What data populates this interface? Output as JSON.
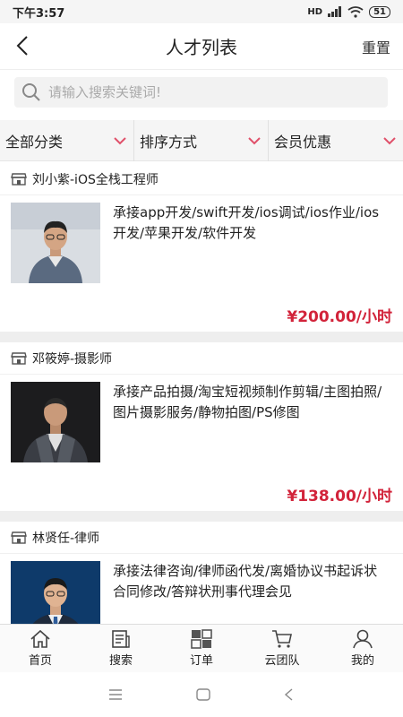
{
  "status_bar": {
    "time": "下午3:57",
    "signal": "HD",
    "battery": "51"
  },
  "header": {
    "title": "人才列表",
    "reset_label": "重置"
  },
  "search": {
    "placeholder": "请输入搜索关键词!"
  },
  "filters": [
    {
      "label": "全部分类"
    },
    {
      "label": "排序方式"
    },
    {
      "label": "会员优惠"
    }
  ],
  "listings": [
    {
      "name": "刘小紫-iOS全栈工程师",
      "description": "承接app开发/swift开发/ios调试/ios作业/ios开发/苹果开发/软件开发",
      "price": "¥200.00/小时"
    },
    {
      "name": "邓筱婷-摄影师",
      "description": "承接产品拍摄/淘宝短视频制作剪辑/主图拍照/图片摄影服务/静物拍图/PS修图",
      "price": "¥138.00/小时"
    },
    {
      "name": "林贤任-律师",
      "description": "承接法律咨询/律师函代发/离婚协议书起诉状合同修改/答辩状刑事代理会见",
      "price": ""
    }
  ],
  "tab_bar": [
    {
      "label": "首页",
      "icon": "home-icon"
    },
    {
      "label": "搜索",
      "icon": "document-icon"
    },
    {
      "label": "订单",
      "icon": "grid-icon"
    },
    {
      "label": "云团队",
      "icon": "cart-icon"
    },
    {
      "label": "我的",
      "icon": "user-icon"
    }
  ],
  "colors": {
    "price": "#d2233a",
    "chevron": "#e0506a"
  }
}
